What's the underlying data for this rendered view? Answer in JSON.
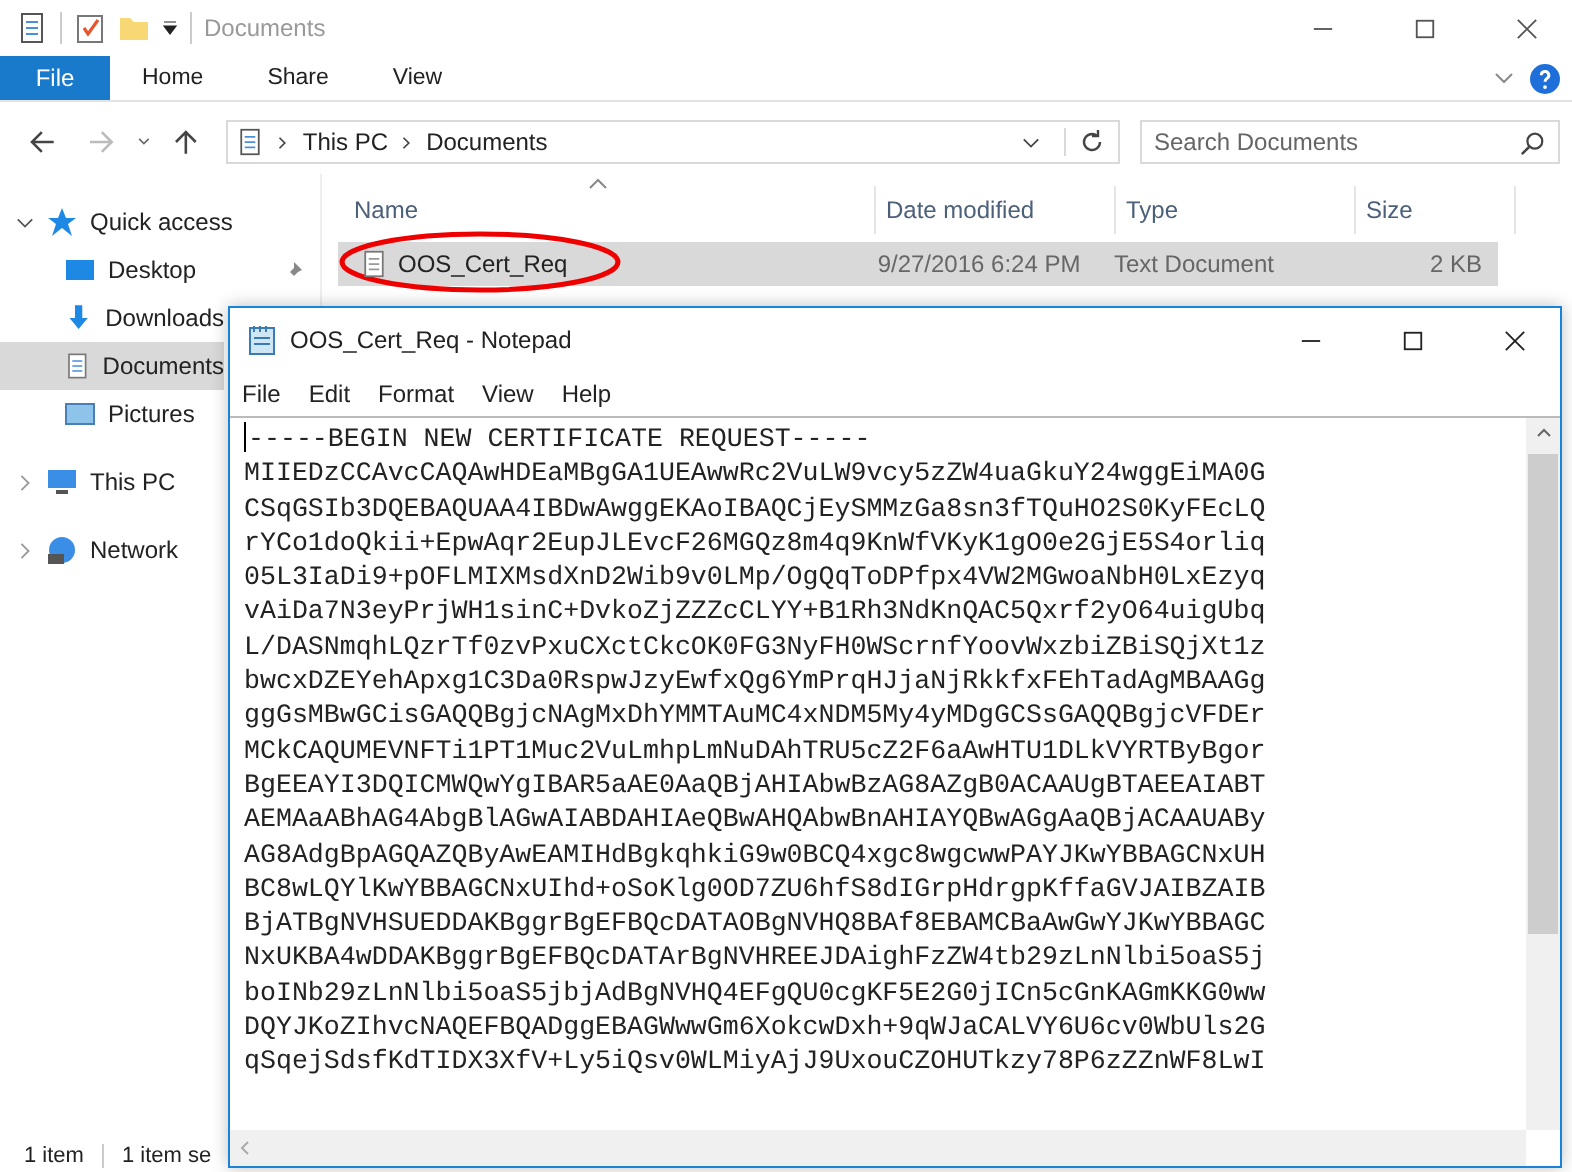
{
  "explorer": {
    "title": "Documents",
    "file_tab": "File",
    "ribbon_tabs": [
      "Home",
      "Share",
      "View"
    ],
    "breadcrumbs": [
      "This PC",
      "Documents"
    ],
    "search": {
      "placeholder": "Search Documents"
    },
    "sidebar": [
      {
        "label": "Quick access",
        "kind": "star",
        "expanded": true,
        "children": [
          {
            "label": "Desktop",
            "kind": "desktop",
            "selected": false,
            "pinned": true
          },
          {
            "label": "Downloads",
            "kind": "download",
            "selected": false
          },
          {
            "label": "Documents",
            "kind": "document",
            "selected": true
          },
          {
            "label": "Pictures",
            "kind": "pictures",
            "selected": false
          }
        ]
      },
      {
        "label": "This PC",
        "kind": "pc",
        "expanded": false
      },
      {
        "label": "Network",
        "kind": "network",
        "expanded": false
      }
    ],
    "columns": [
      "Name",
      "Date modified",
      "Type",
      "Size"
    ],
    "files": [
      {
        "name": "OOS_Cert_Req",
        "date": "9/27/2016 6:24 PM",
        "type": "Text Document",
        "size": "2 KB",
        "selected": true,
        "circled": true
      }
    ],
    "status_bar": [
      "1 item",
      "1 item se"
    ]
  },
  "notepad": {
    "title": "OOS_Cert_Req - Notepad",
    "menu": [
      "File",
      "Edit",
      "Format",
      "View",
      "Help"
    ],
    "lines": [
      "-----BEGIN NEW CERTIFICATE REQUEST-----",
      "MIIEDzCCAvcCAQAwHDEaMBgGA1UEAwwRc2VuLW9vcy5zZW4uaGkuY24wggEiMA0G",
      "CSqGSIb3DQEBAQUAA4IBDwAwggEKAoIBAQCjEySMMzGa8sn3fTQuHO2S0KyFEcLQ",
      "rYCo1doQkii+EpwAqr2EupJLEvcF26MGQz8m4q9KnWfVKyK1gO0e2GjE5S4orliq",
      "05L3IaDi9+pOFLMIXMsdXnD2Wib9v0LMp/OgQqToDPfpx4VW2MGwoaNbH0LxEzyq",
      "vAiDa7N3eyPrjWH1sinC+DvkoZjZZZcCLYY+B1Rh3NdKnQAC5Qxrf2yO64uigUbq",
      "L/DASNmqhLQzrTf0zvPxuCXctCkcOK0FG3NyFH0WScrnfYoovWxzbiZBiSQjXt1z",
      "bwcxDZEYehApxg1C3Da0RspwJzyEwfxQg6YmPrqHJjaNjRkkfxFEhTadAgMBAAGg",
      "ggGsMBwGCisGAQQBgjcNAgMxDhYMMTAuMC4xNDM5My4yMDgGCSsGAQQBgjcVFDEr",
      "MCkCAQUMEVNFTi1PT1Muc2VuLmhpLmNuDAhTRU5cZ2F6aAwHTU1DLkVYRTByBgor",
      "BgEEAYI3DQICMWQwYgIBAR5aAE0AaQBjAHIAbwBzAG8AZgB0ACAAUgBTAEEAIABT",
      "AEMAaABhAG4AbgBlAGwAIABDAHIAeQBwAHQAbwBnAHIAYQBwAGgAaQBjACAAUABy",
      "AG8AdgBpAGQAZQByAwEAMIHdBgkqhkiG9w0BCQ4xgc8wgcwwPAYJKwYBBAGCNxUH",
      "BC8wLQYlKwYBBAGCNxUIhd+oSoKlg0OD7ZU6hfS8dIGrpHdrgpKffaGVJAIBZAIB",
      "BjATBgNVHSUEDDAKBggrBgEFBQcDATAOBgNVHQ8BAf8EBAMCBaAwGwYJKwYBBAGC",
      "NxUKBA4wDDAKBggrBgEFBQcDATArBgNVHREEJDAighFzZW4tb29zLnNlbi5oaS5j",
      "boINb29zLnNlbi5oaS5jbjAdBgNVHQ4EFgQU0cgKF5E2G0jICn5cGnKAGmKKG0ww",
      "DQYJKoZIhvcNAQEFBQADggEBAGWwwGm6XokcwDxh+9qWJaCALVY6U6cv0WbUls2G",
      "qSqejSdsfKdTIDX3XfV+Ly5iQsv0WLMiyAjJ9UxouCZOHUTkzy78P6zZZnWF8LwI"
    ]
  }
}
